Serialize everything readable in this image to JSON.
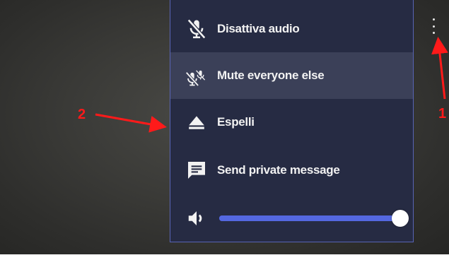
{
  "menu": {
    "items": [
      {
        "label": "Disattiva audio",
        "icon": "microphone-muted-icon"
      },
      {
        "label": "Mute everyone else",
        "icon": "mute-all-icon",
        "hovered": true
      },
      {
        "label": "Espelli",
        "icon": "eject-icon"
      },
      {
        "label": "Send private message",
        "icon": "chat-message-icon"
      }
    ],
    "volume": {
      "icon": "speaker-icon",
      "level": 1.0
    }
  },
  "kebab": {
    "icon": "more-vertical-icon"
  },
  "annotations": {
    "label_1": "1",
    "label_2": "2",
    "color": "#ff1a1a"
  },
  "colors": {
    "menu_bg": "#262b43",
    "menu_border": "#5864b5",
    "hover_bg": "#3b4058",
    "slider": "#5468e0"
  }
}
